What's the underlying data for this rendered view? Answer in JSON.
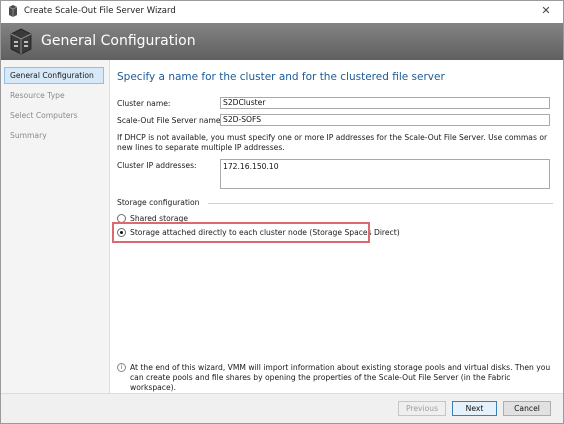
{
  "window": {
    "title": "Create Scale-Out File Server Wizard",
    "close_glyph": "✕"
  },
  "header": {
    "title": "General Configuration",
    "icon": "server-cluster-icon"
  },
  "sidebar": {
    "items": [
      {
        "label": "General Configuration",
        "active": true
      },
      {
        "label": "Resource Type",
        "active": false
      },
      {
        "label": "Select Computers",
        "active": false
      },
      {
        "label": "Summary",
        "active": false
      }
    ]
  },
  "main": {
    "heading": "Specify a name for the cluster and for the clustered file server",
    "cluster_name_label": "Cluster name:",
    "cluster_name_value": "S2DCluster",
    "sofs_name_label": "Scale-Out File Server name:",
    "sofs_name_value": "S2D-SOFS",
    "dhcp_info": "If DHCP is not available, you must specify one or more IP addresses for the Scale-Out File Server. Use commas or new lines to separate multiple IP addresses.",
    "ip_label": "Cluster IP addresses:",
    "ip_value": "172.16.150.10",
    "storage_group_title": "Storage configuration",
    "storage_options": [
      {
        "label": "Shared storage",
        "checked": false
      },
      {
        "label": "Storage attached directly to each cluster node (Storage Spaces Direct)",
        "checked": true
      }
    ],
    "note_icon": "info-icon",
    "note": "At the end of this wizard, VMM will import information about existing storage pools and virtual disks. Then you can create pools and file shares by opening the properties of the Scale-Out File Server (in the Fabric workspace)."
  },
  "footer": {
    "previous_label": "Previous",
    "next_label": "Next",
    "cancel_label": "Cancel"
  },
  "colors": {
    "heading": "#1c5a96",
    "header_bg": "#707070",
    "sidebar_active_bg": "#d7e9f8",
    "highlight_border": "#d96a70"
  }
}
